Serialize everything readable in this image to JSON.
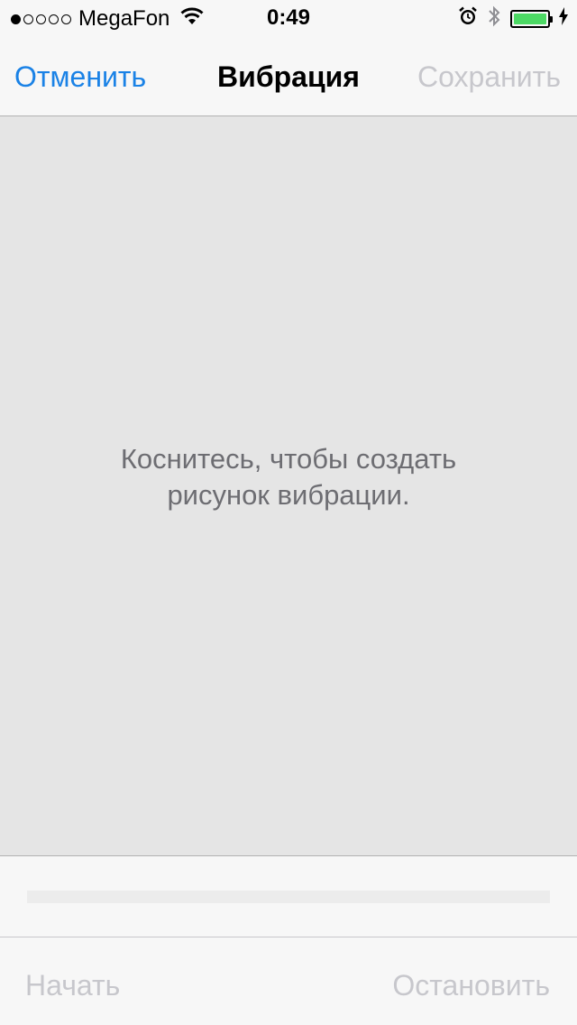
{
  "status_bar": {
    "signal_dots_filled": 1,
    "signal_dots_total": 5,
    "carrier": "MegaFon",
    "time": "0:49",
    "battery_level": 1.0,
    "battery_color": "#4cd964"
  },
  "nav": {
    "cancel_label": "Отменить",
    "title": "Вибрация",
    "save_label": "Сохранить"
  },
  "canvas": {
    "hint": "Коснитесь, чтобы создать\nрисунок вибрации."
  },
  "playback": {
    "progress": 0
  },
  "toolbar": {
    "start_label": "Начать",
    "stop_label": "Остановить"
  },
  "colors": {
    "accent": "#1a82e6",
    "disabled": "#c7c7cc",
    "canvas_bg": "#e5e5e5"
  }
}
